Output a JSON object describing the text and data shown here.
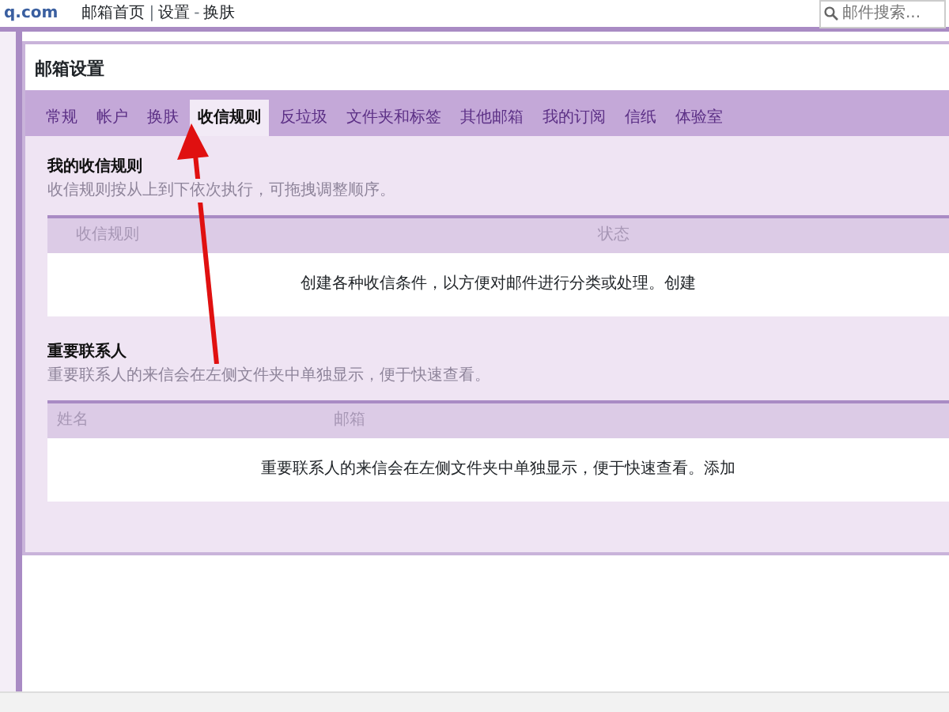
{
  "header": {
    "logo": "q.com",
    "breadcrumb": [
      "邮箱首页",
      "设置",
      "换肤"
    ],
    "separators": [
      "|",
      "-"
    ],
    "search": {
      "placeholder": "邮件搜索..."
    }
  },
  "page_title": "邮箱设置",
  "tabs": [
    {
      "label": "常规",
      "selected": false
    },
    {
      "label": "帐户",
      "selected": false
    },
    {
      "label": "换肤",
      "selected": false
    },
    {
      "label": "收信规则",
      "selected": true
    },
    {
      "label": "反垃圾",
      "selected": false
    },
    {
      "label": "文件夹和标签",
      "selected": false
    },
    {
      "label": "其他邮箱",
      "selected": false
    },
    {
      "label": "我的订阅",
      "selected": false
    },
    {
      "label": "信纸",
      "selected": false
    },
    {
      "label": "体验室",
      "selected": false
    }
  ],
  "sections": [
    {
      "title": "我的收信规则",
      "description": "收信规则按从上到下依次执行，可拖拽调整顺序。",
      "columns": [
        "收信规则",
        "状态"
      ],
      "empty_text": "创建各种收信条件，以方便对邮件进行分类或处理。",
      "action": "创建"
    },
    {
      "title": "重要联系人",
      "description": "重要联系人的来信会在左侧文件夹中单独显示，便于快速查看。",
      "columns": [
        "姓名",
        "邮箱"
      ],
      "empty_text": "重要联系人的来信会在左侧文件夹中单独显示，便于快速查看。",
      "action": "添加"
    }
  ]
}
